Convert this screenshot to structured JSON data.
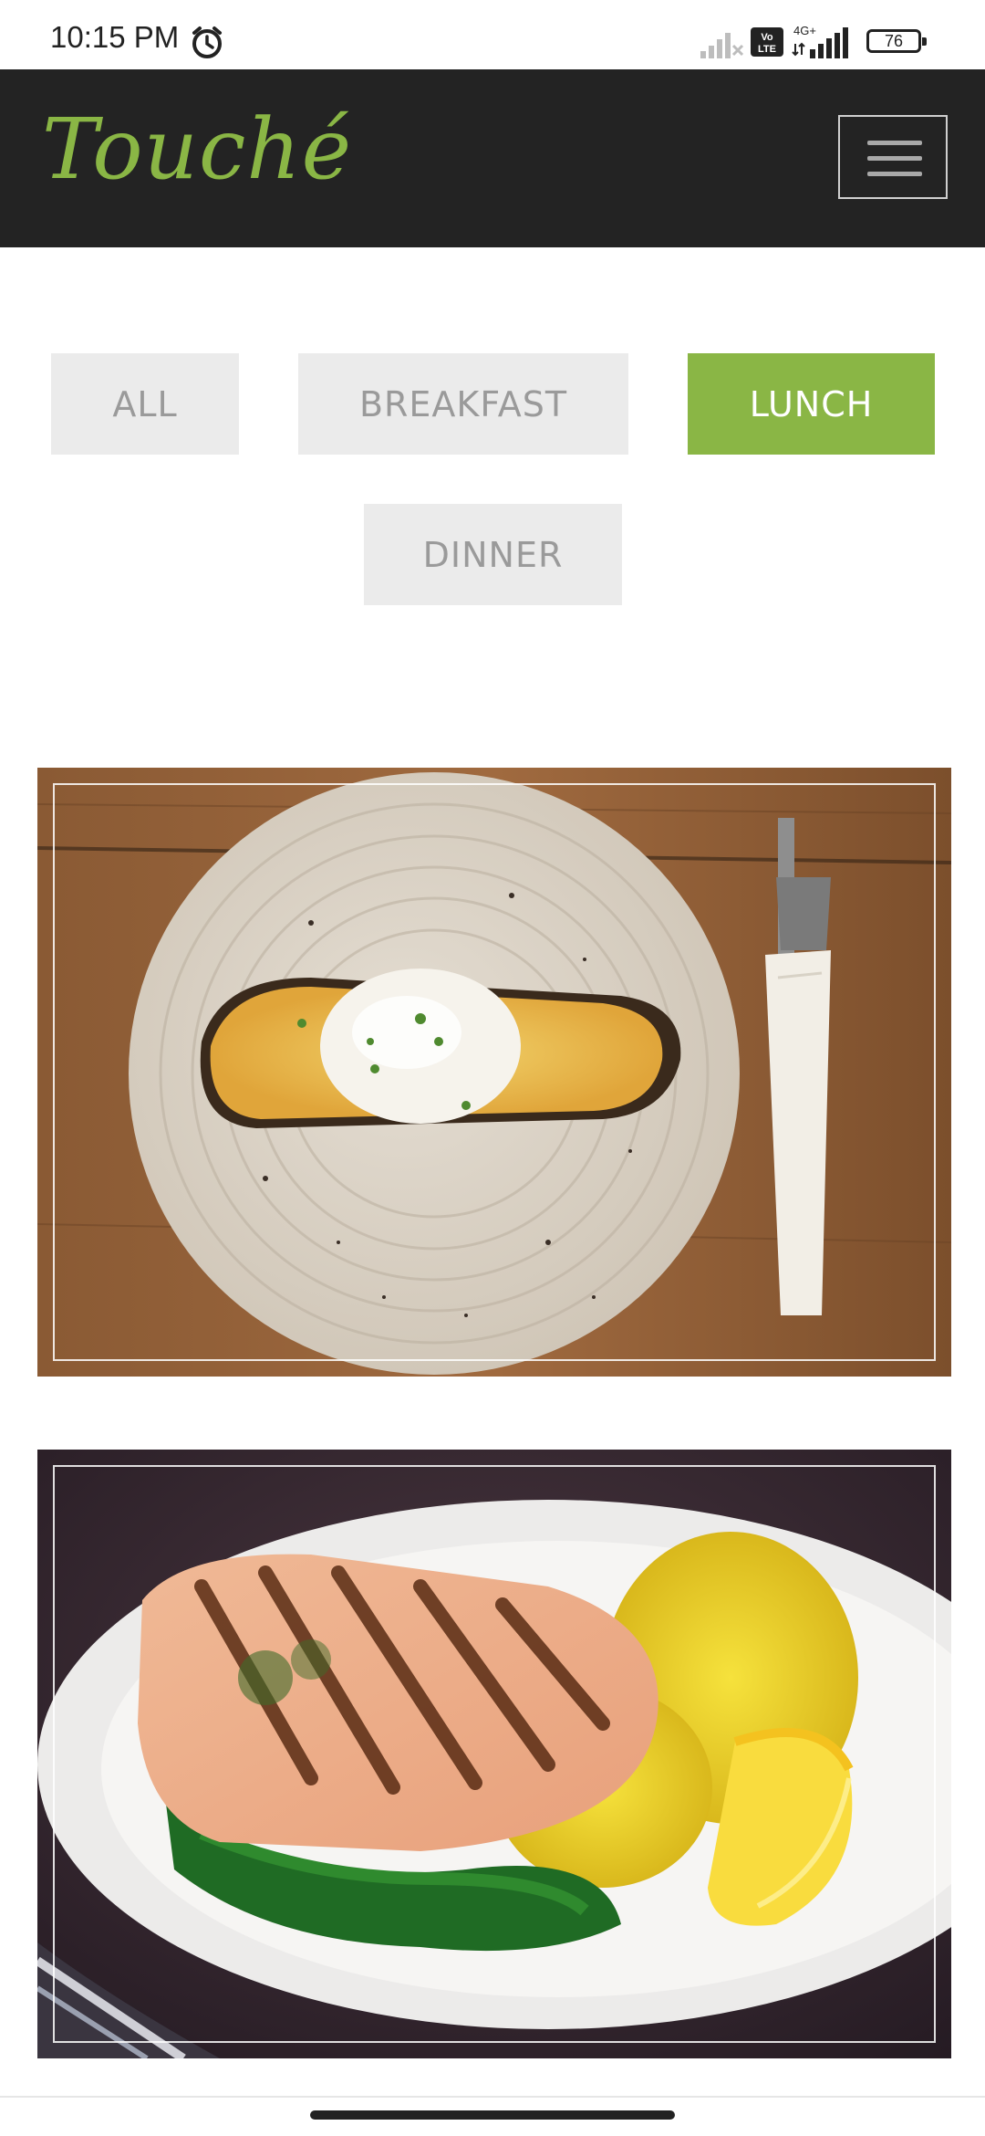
{
  "status_bar": {
    "time": "10:15 PM",
    "battery": "76",
    "network": "4G+",
    "volte": "VoLTE"
  },
  "header": {
    "brand": "Touché",
    "brand_color": "#8ab645",
    "background": "#232323"
  },
  "filters": [
    {
      "label": "ALL",
      "active": false
    },
    {
      "label": "BREAKFAST",
      "active": false
    },
    {
      "label": "LUNCH",
      "active": true
    },
    {
      "label": "DINNER",
      "active": false
    }
  ],
  "gallery": [
    {
      "image": "poached-egg-toast-on-plate"
    },
    {
      "image": "grilled-salmon-with-rice-and-lemon"
    }
  ]
}
